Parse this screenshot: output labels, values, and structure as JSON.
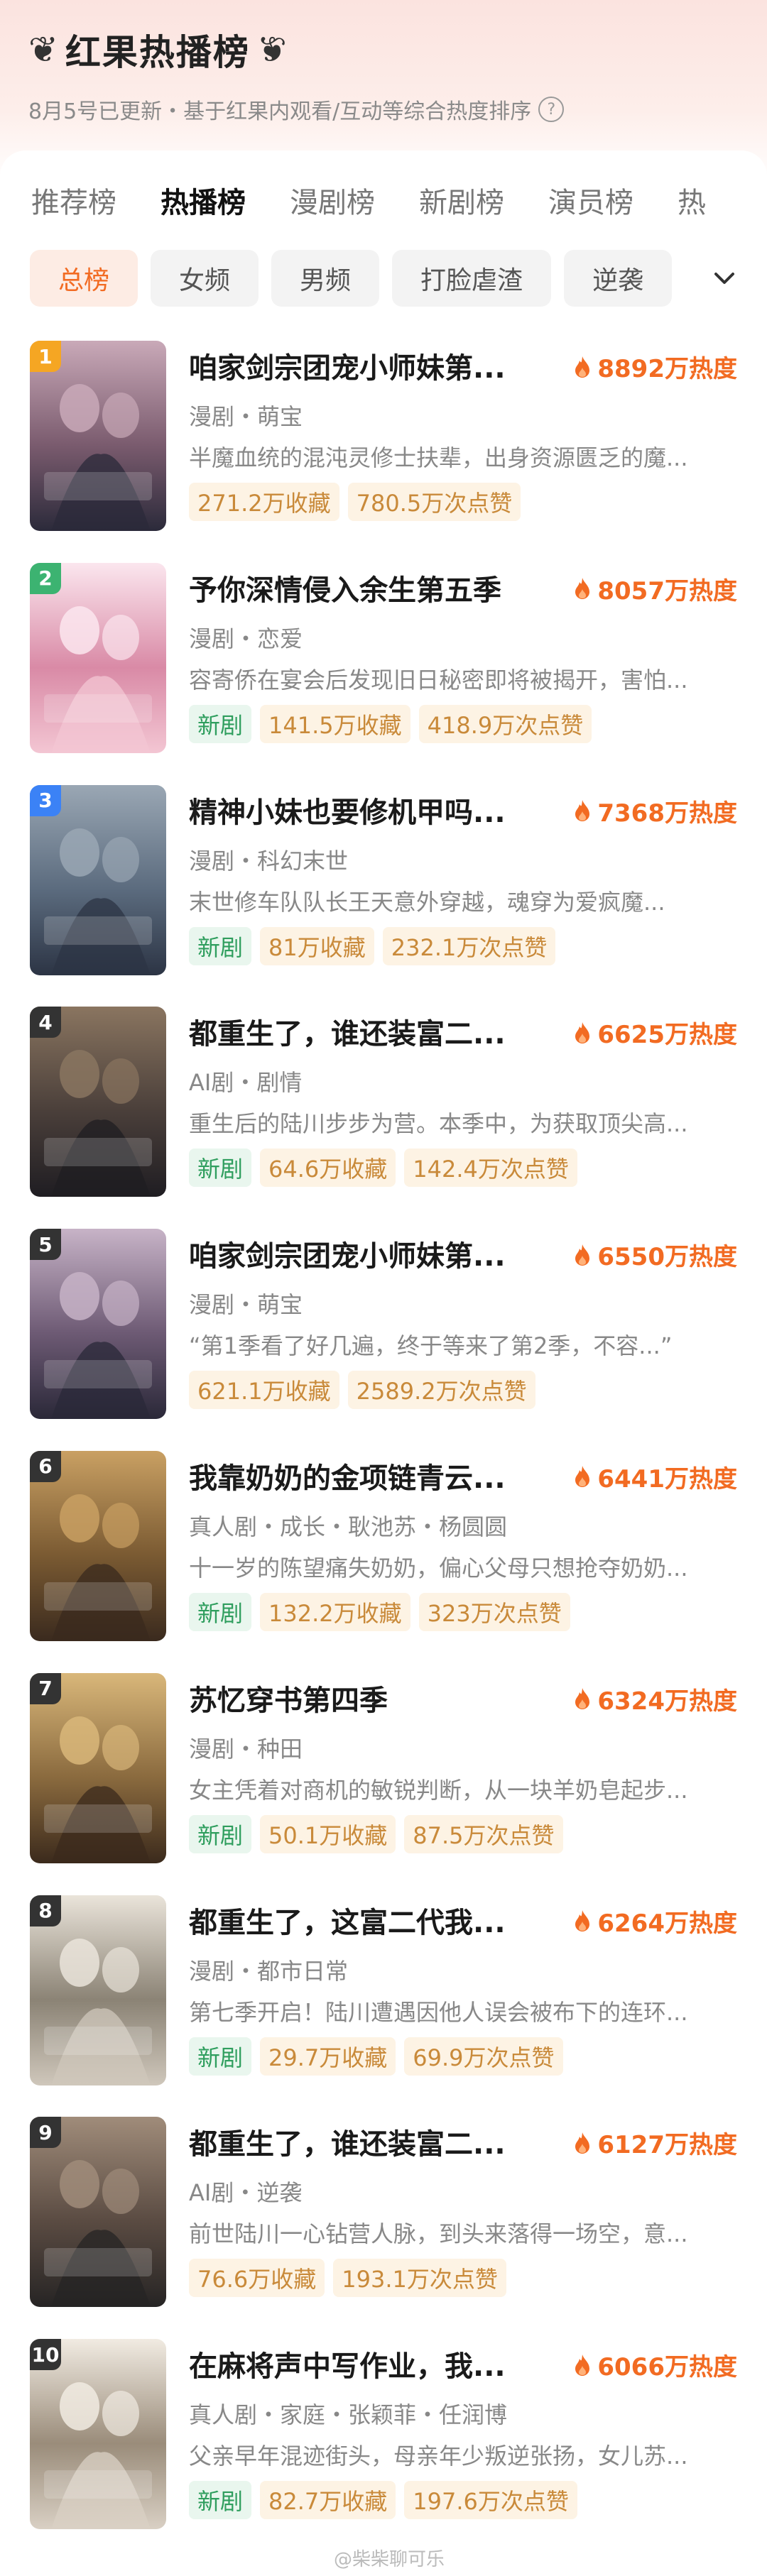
{
  "header": {
    "title": "红果热播榜",
    "laurel_left": "❦",
    "laurel_right": "❦",
    "subtitle": "8月5号已更新・基于红果内观看/互动等综合热度排序",
    "help_icon": "?"
  },
  "tabs": [
    {
      "label": "推荐榜",
      "active": false
    },
    {
      "label": "热播榜",
      "active": true
    },
    {
      "label": "漫剧榜",
      "active": false
    },
    {
      "label": "新剧榜",
      "active": false
    },
    {
      "label": "演员榜",
      "active": false
    },
    {
      "label": "热",
      "active": false
    }
  ],
  "chips": [
    {
      "label": "总榜",
      "active": true
    },
    {
      "label": "女频",
      "active": false
    },
    {
      "label": "男频",
      "active": false
    },
    {
      "label": "打脸虐渣",
      "active": false
    },
    {
      "label": "逆袭",
      "active": false
    }
  ],
  "colors": {
    "accent": "#f26b22",
    "rank1": "#f5a623",
    "rank2": "#3cb371",
    "rank3": "#3b82f6",
    "rank_other": "#333333"
  },
  "items": [
    {
      "rank": "1",
      "title": "咱家剑宗团宠小师妹第...",
      "heat": "8892万热度",
      "meta": "漫剧・萌宝",
      "desc": "半魔血统的混沌灵修士扶辈，出身资源匮乏的魔...",
      "tags": [
        "271.2万收藏",
        "780.5万次点赞"
      ],
      "is_new": false,
      "new_label": ""
    },
    {
      "rank": "2",
      "title": "予你深情侵入余生第五季",
      "heat": "8057万热度",
      "meta": "漫剧・恋爱",
      "desc": "容寄侨在宴会后发现旧日秘密即将被揭开，害怕...",
      "tags": [
        "141.5万收藏",
        "418.9万次点赞"
      ],
      "is_new": true,
      "new_label": "新剧"
    },
    {
      "rank": "3",
      "title": "精神小妹也要修机甲吗...",
      "heat": "7368万热度",
      "meta": "漫剧・科幻末世",
      "desc": "末世修车队队长王天意外穿越，魂穿为爱疯魔...",
      "tags": [
        "81万收藏",
        "232.1万次点赞"
      ],
      "is_new": true,
      "new_label": "新剧"
    },
    {
      "rank": "4",
      "title": "都重生了，谁还装富二...",
      "heat": "6625万热度",
      "meta": "AI剧・剧情",
      "desc": "重生后的陆川步步为营。本季中，为获取顶尖高...",
      "tags": [
        "64.6万收藏",
        "142.4万次点赞"
      ],
      "is_new": true,
      "new_label": "新剧"
    },
    {
      "rank": "5",
      "title": "咱家剑宗团宠小师妹第...",
      "heat": "6550万热度",
      "meta": "漫剧・萌宝",
      "desc": "“第1季看了好几遍，终于等来了第2季，不容...”",
      "tags": [
        "621.1万收藏",
        "2589.2万次点赞"
      ],
      "is_new": false,
      "new_label": ""
    },
    {
      "rank": "6",
      "title": "我靠奶奶的金项链青云...",
      "heat": "6441万热度",
      "meta": "真人剧・成长・耿池苏・杨圆圆",
      "desc": "十一岁的陈望痛失奶奶，偏心父母只想抢夺奶奶...",
      "tags": [
        "132.2万收藏",
        "323万次点赞"
      ],
      "is_new": true,
      "new_label": "新剧"
    },
    {
      "rank": "7",
      "title": "苏忆穿书第四季",
      "heat": "6324万热度",
      "meta": "漫剧・种田",
      "desc": "女主凭着对商机的敏锐判断，从一块羊奶皂起步...",
      "tags": [
        "50.1万收藏",
        "87.5万次点赞"
      ],
      "is_new": true,
      "new_label": "新剧"
    },
    {
      "rank": "8",
      "title": "都重生了，这富二代我...",
      "heat": "6264万热度",
      "meta": "漫剧・都市日常",
      "desc": "第七季开启！陆川遭遇因他人误会被布下的连环...",
      "tags": [
        "29.7万收藏",
        "69.9万次点赞"
      ],
      "is_new": true,
      "new_label": "新剧"
    },
    {
      "rank": "9",
      "title": "都重生了，谁还装富二...",
      "heat": "6127万热度",
      "meta": "AI剧・逆袭",
      "desc": "前世陆川一心钻营人脉，到头来落得一场空，意...",
      "tags": [
        "76.6万收藏",
        "193.1万次点赞"
      ],
      "is_new": false,
      "new_label": ""
    },
    {
      "rank": "10",
      "title": "在麻将声中写作业，我...",
      "heat": "6066万热度",
      "meta": "真人剧・家庭・张颖菲・任润博",
      "desc": "父亲早年混迹街头，母亲年少叛逆张扬，女儿苏...",
      "tags": [
        "82.7万收藏",
        "197.6万次点赞"
      ],
      "is_new": true,
      "new_label": "新剧"
    }
  ],
  "watermark": "@柴柴聊可乐"
}
